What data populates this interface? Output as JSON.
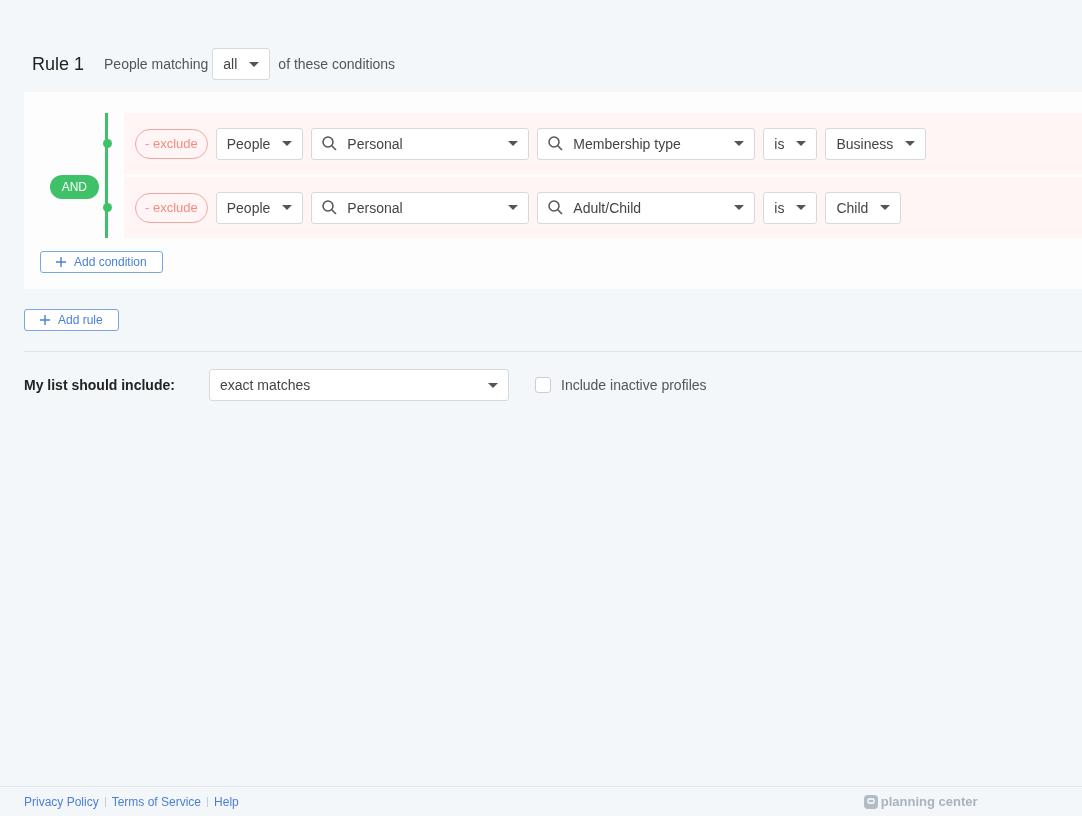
{
  "rule": {
    "title": "Rule 1",
    "prefix": "People matching",
    "match": "all",
    "suffix": "of these conditions"
  },
  "conjunction": "AND",
  "conditions": [
    {
      "exclude_label": "- exclude",
      "fields": [
        {
          "value": "People",
          "kind": "plain"
        },
        {
          "value": "Personal",
          "kind": "search"
        },
        {
          "value": "Membership type",
          "kind": "search"
        },
        {
          "value": "is",
          "kind": "plain"
        },
        {
          "value": "Business",
          "kind": "plain"
        }
      ]
    },
    {
      "exclude_label": "- exclude",
      "fields": [
        {
          "value": "People",
          "kind": "plain"
        },
        {
          "value": "Personal",
          "kind": "search"
        },
        {
          "value": "Adult/Child",
          "kind": "search"
        },
        {
          "value": "is",
          "kind": "plain"
        },
        {
          "value": "Child",
          "kind": "plain"
        }
      ]
    }
  ],
  "add_condition": "Add condition",
  "add_rule": "Add rule",
  "include": {
    "label": "My list should include:",
    "value": "exact matches",
    "checkbox_label": "Include inactive profiles",
    "checked": false
  },
  "footer": {
    "links": [
      "Privacy Policy",
      "Terms of Service",
      "Help"
    ],
    "logo": "planning center"
  }
}
